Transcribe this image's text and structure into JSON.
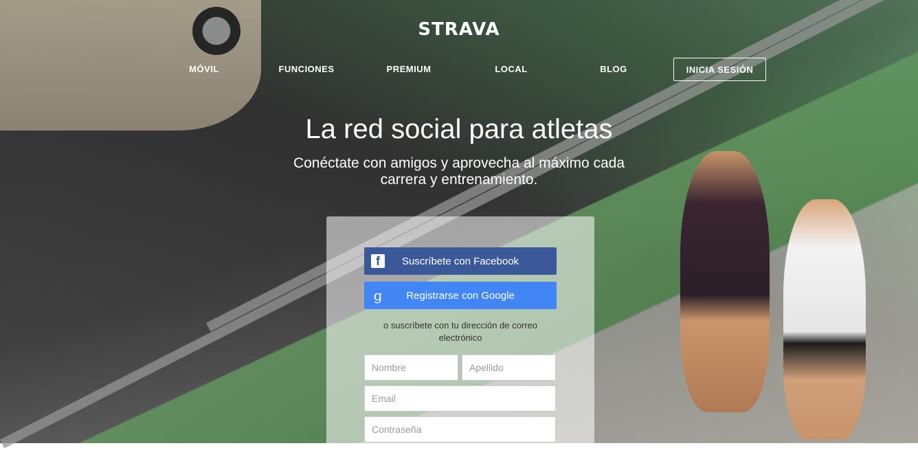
{
  "brand": {
    "logo_text": "STRAVA"
  },
  "nav": {
    "items": [
      "MÓVIL",
      "FUNCIONES",
      "PREMIUM",
      "LOCAL",
      "BLOG"
    ],
    "login_label": "INICIA SESIÓN"
  },
  "hero": {
    "headline": "La red social para atletas",
    "subline": "Conéctate con amigos y aprovecha al máximo cada carrera y entrenamiento."
  },
  "signup": {
    "facebook_label": "Suscríbete con Facebook",
    "google_label": "Registrarse con Google",
    "or_text": "o suscríbete con tu dirección de correo electrónico",
    "first_name_placeholder": "Nombre",
    "last_name_placeholder": "Apellido",
    "email_placeholder": "Email",
    "password_placeholder": "Contraseña"
  },
  "icons": {
    "facebook": "facebook-icon",
    "google": "google-icon"
  },
  "colors": {
    "facebook": "#3b5998",
    "google": "#4285f4"
  }
}
